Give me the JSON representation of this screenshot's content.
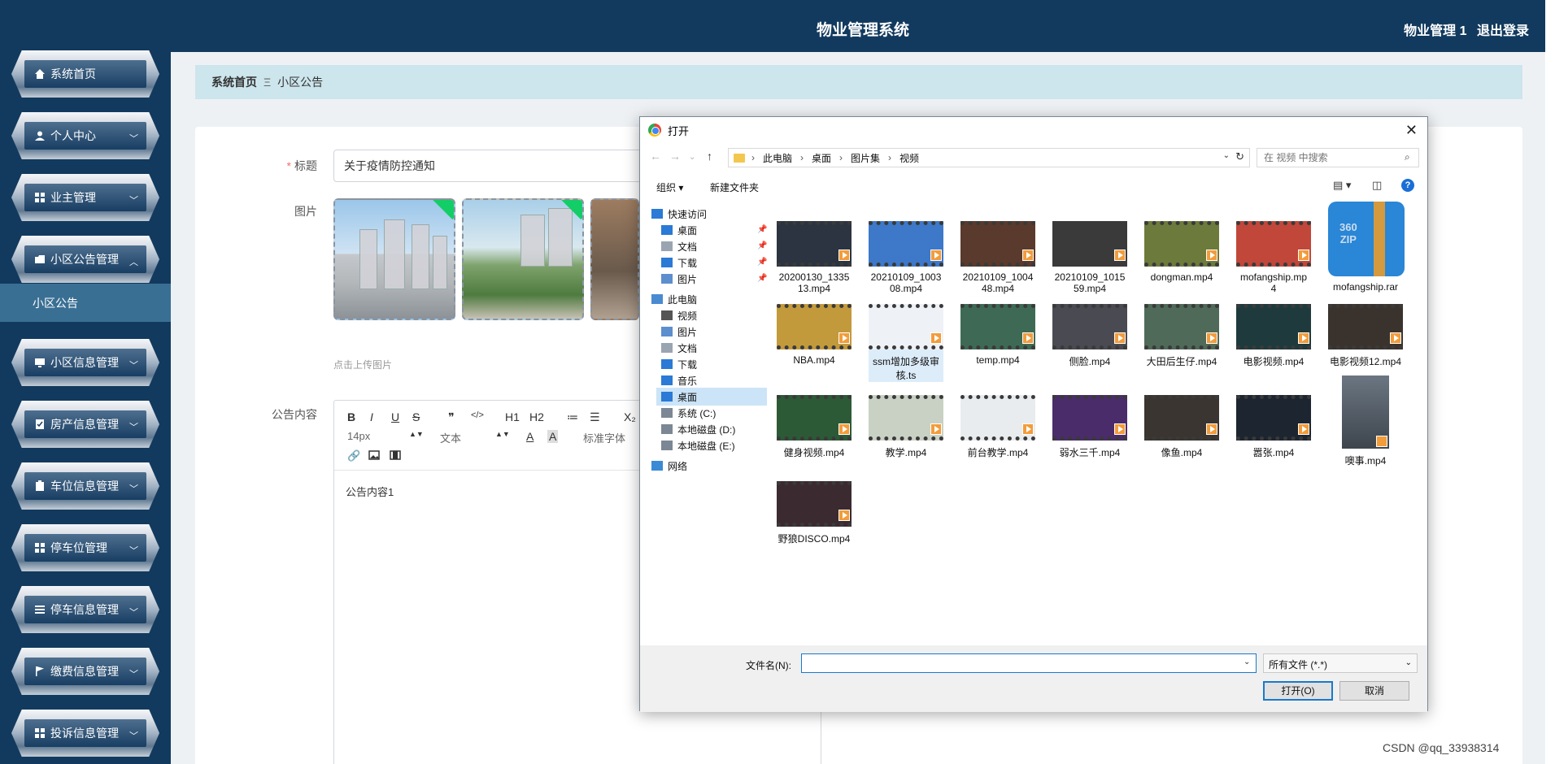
{
  "header": {
    "title": "物业管理系统",
    "user": "物业管理 1",
    "logout": "退出登录"
  },
  "sidebar": {
    "items": [
      {
        "label": "系统首页",
        "icon": "home-icon",
        "has_chevron": false
      },
      {
        "label": "个人中心",
        "icon": "user-icon",
        "has_chevron": true
      },
      {
        "label": "业主管理",
        "icon": "grid-icon",
        "has_chevron": true
      },
      {
        "label": "小区公告管理",
        "icon": "folder-icon",
        "has_chevron": true,
        "expanded": true
      },
      {
        "label": "小区信息管理",
        "icon": "monitor-icon",
        "has_chevron": true
      },
      {
        "label": "房产信息管理",
        "icon": "checklist-icon",
        "has_chevron": true
      },
      {
        "label": "车位信息管理",
        "icon": "clipboard-icon",
        "has_chevron": true
      },
      {
        "label": "停车位管理",
        "icon": "grid-icon",
        "has_chevron": true
      },
      {
        "label": "停车信息管理",
        "icon": "list-icon",
        "has_chevron": true
      },
      {
        "label": "缴费信息管理",
        "icon": "flag-icon",
        "has_chevron": true
      },
      {
        "label": "投诉信息管理",
        "icon": "grid-icon",
        "has_chevron": true
      }
    ],
    "active_sub": "小区公告"
  },
  "breadcrumb": {
    "home": "系统首页",
    "separator": "Ξ",
    "current": "小区公告"
  },
  "form": {
    "title_label": "标题",
    "title_value": "关于疫情防控通知",
    "image_label": "图片",
    "upload_hint": "点击上传图片",
    "content_label": "公告内容",
    "content_value": "公告内容1",
    "toolbar": {
      "font_size": "14px",
      "text_style": "文本",
      "font_family": "标准字体",
      "row1": [
        "B",
        "I",
        "U",
        "S",
        "❞",
        "</>",
        "H1",
        "H2",
        "≔",
        "☰",
        "X₂"
      ]
    }
  },
  "dialog": {
    "title": "打开",
    "path": [
      "此电脑",
      "桌面",
      "图片集",
      "视频"
    ],
    "search_placeholder": "在 视频 中搜索",
    "organize": "组织 ▾",
    "new_folder": "新建文件夹",
    "tree": [
      {
        "label": "快速访问",
        "icon": "star-icon",
        "pinned": false,
        "indent": 0
      },
      {
        "label": "桌面",
        "icon": "desktop-icon",
        "pinned": true,
        "indent": 1
      },
      {
        "label": "文档",
        "icon": "document-icon",
        "pinned": true,
        "indent": 1
      },
      {
        "label": "下载",
        "icon": "download-icon",
        "pinned": true,
        "indent": 1
      },
      {
        "label": "图片",
        "icon": "picture-icon",
        "pinned": true,
        "indent": 1
      },
      {
        "label": "此电脑",
        "icon": "computer-icon",
        "pinned": false,
        "indent": 0
      },
      {
        "label": "视频",
        "icon": "video-icon",
        "pinned": false,
        "indent": 1
      },
      {
        "label": "图片",
        "icon": "picture-icon",
        "pinned": false,
        "indent": 1
      },
      {
        "label": "文档",
        "icon": "document-icon",
        "pinned": false,
        "indent": 1
      },
      {
        "label": "下载",
        "icon": "download-icon",
        "pinned": false,
        "indent": 1
      },
      {
        "label": "音乐",
        "icon": "music-icon",
        "pinned": false,
        "indent": 1
      },
      {
        "label": "桌面",
        "icon": "desktop-icon",
        "pinned": false,
        "indent": 1,
        "selected": true
      },
      {
        "label": "系统 (C:)",
        "icon": "drive-icon",
        "pinned": false,
        "indent": 1
      },
      {
        "label": "本地磁盘 (D:)",
        "icon": "drive-icon",
        "pinned": false,
        "indent": 1
      },
      {
        "label": "本地磁盘 (E:)",
        "icon": "drive-icon",
        "pinned": false,
        "indent": 1
      },
      {
        "label": "网络",
        "icon": "network-icon",
        "pinned": false,
        "indent": 0
      }
    ],
    "files": [
      {
        "name": "20200130_133513.mp4",
        "lines": [
          "20200130_1335",
          "13.mp4"
        ],
        "color": "#2b3440"
      },
      {
        "name": "20210109_100308.mp4",
        "lines": [
          "20210109_1003",
          "08.mp4"
        ],
        "color": "#3d78c9"
      },
      {
        "name": "20210109_100448.mp4",
        "lines": [
          "20210109_1004",
          "48.mp4"
        ],
        "color": "#5a3a2c"
      },
      {
        "name": "20210109_101559.mp4",
        "lines": [
          "20210109_1015",
          "59.mp4"
        ],
        "color": "#3a3a3a"
      },
      {
        "name": "dongman.mp4",
        "lines": [
          "dongman.mp4"
        ],
        "color": "#6c7a3c"
      },
      {
        "name": "mofangship.mp4",
        "lines": [
          "mofangship.mp",
          "4"
        ],
        "color": "#c0473a"
      },
      {
        "name": "mofangship.rar",
        "lines": [
          "mofangship.rar"
        ],
        "color": "#2a86d6",
        "archive": true
      },
      {
        "name": "NBA.mp4",
        "lines": [
          "NBA.mp4"
        ],
        "color": "#c29a3c"
      },
      {
        "name": "ssm增加多级审核.ts",
        "lines": [
          "ssm增加多级审",
          "核.ts"
        ],
        "color": "#eef2f7",
        "selected": true
      },
      {
        "name": "temp.mp4",
        "lines": [
          "temp.mp4"
        ],
        "color": "#3e6a55"
      },
      {
        "name": "侧脸.mp4",
        "lines": [
          "侧脸.mp4"
        ],
        "color": "#4a4a52"
      },
      {
        "name": "大田后生仔.mp4",
        "lines": [
          "大田后生仔.mp4"
        ],
        "color": "#4f6a58"
      },
      {
        "name": "电影视频.mp4",
        "lines": [
          "电影视频.mp4"
        ],
        "color": "#1f3a3d"
      },
      {
        "name": "电影视频12.mp4",
        "lines": [
          "电影视频12.mp4"
        ],
        "color": "#3a332d"
      },
      {
        "name": "健身视频.mp4",
        "lines": [
          "健身视频.mp4"
        ],
        "color": "#2d5a36"
      },
      {
        "name": "教学.mp4",
        "lines": [
          "教学.mp4"
        ],
        "color": "#c9d1c4"
      },
      {
        "name": "前台教学.mp4",
        "lines": [
          "前台教学.mp4"
        ],
        "color": "#e9ecef"
      },
      {
        "name": "弱水三千.mp4",
        "lines": [
          "弱水三千.mp4"
        ],
        "color": "#4a2c6a"
      },
      {
        "name": "像鱼.mp4",
        "lines": [
          "像鱼.mp4"
        ],
        "color": "#3a3530"
      },
      {
        "name": "嚣张.mp4",
        "lines": [
          "嚣张.mp4"
        ],
        "color": "#1d2530"
      },
      {
        "name": "噢事.mp4",
        "lines": [
          "噢事.mp4"
        ],
        "color": "#4a5560",
        "portrait": true
      },
      {
        "name": "野狼DISCO.mp4",
        "lines": [
          "野狼DISCO.mp4"
        ],
        "color": "#3b2a30"
      }
    ],
    "filename_label": "文件名(N):",
    "filename_value": "",
    "filetype": "所有文件 (*.*)",
    "open_btn": "打开(O)",
    "cancel_btn": "取消"
  },
  "watermark": "CSDN @qq_33938314"
}
